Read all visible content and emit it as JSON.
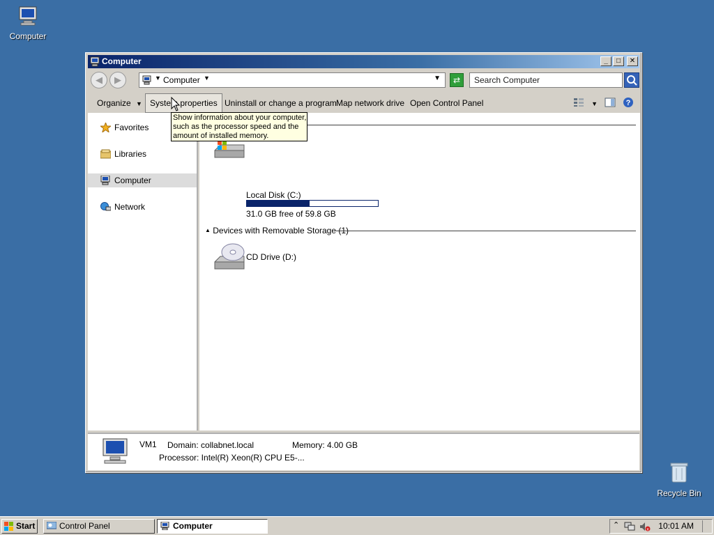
{
  "desktop": {
    "computer_label": "Computer",
    "recycle_label": "Recycle Bin"
  },
  "window": {
    "title": "Computer",
    "address": "Computer",
    "search_placeholder": "Search Computer"
  },
  "toolbar": {
    "organize": "Organize",
    "system_properties": "System properties",
    "uninstall": "Uninstall or change a program",
    "map_drive": "Map network drive",
    "control_panel": "Open Control Panel"
  },
  "nav": {
    "favorites": "Favorites",
    "libraries": "Libraries",
    "computer": "Computer",
    "network": "Network"
  },
  "content": {
    "local_disk_name": "Local Disk (C:)",
    "local_disk_free": "31.0 GB free of 59.8 GB",
    "local_disk_used_fraction": 0.48,
    "removable_header": "Devices with Removable Storage (1)",
    "cd_drive": "CD Drive (D:)"
  },
  "tooltip": {
    "line1": "Show information about your computer,",
    "line2": "such as the processor speed and the",
    "line3": "amount of installed memory."
  },
  "details": {
    "name": "VM1",
    "domain": "Domain: collabnet.local",
    "memory": "Memory: 4.00 GB",
    "processor": "Processor: Intel(R) Xeon(R) CPU E5-..."
  },
  "taskbar": {
    "start": "Start",
    "task1": "Control Panel",
    "task2": "Computer",
    "clock": "10:01 AM"
  },
  "colors": {
    "desktop": "#3a6ea5",
    "titlebar": "#0a246a",
    "usage_bar": "#0a246a"
  }
}
